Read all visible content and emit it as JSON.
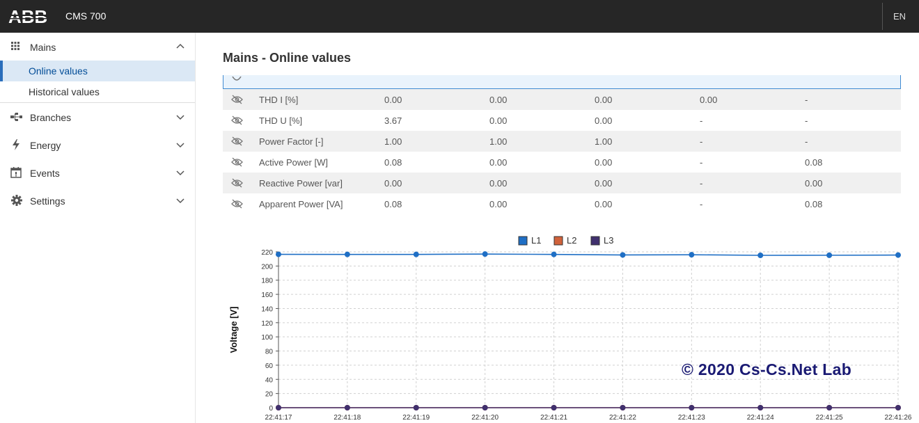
{
  "header": {
    "brand": "ABB",
    "app_title": "CMS 700",
    "language": "EN"
  },
  "sidebar": {
    "groups": [
      {
        "label": "Mains",
        "icon": "grid-icon",
        "expanded": true,
        "items": [
          {
            "label": "Online values",
            "active": true
          },
          {
            "label": "Historical values",
            "active": false
          }
        ]
      },
      {
        "label": "Branches",
        "icon": "branches-icon",
        "expanded": false
      },
      {
        "label": "Energy",
        "icon": "lightning-icon",
        "expanded": false
      },
      {
        "label": "Events",
        "icon": "calendar-icon",
        "expanded": false
      },
      {
        "label": "Settings",
        "icon": "gear-icon",
        "expanded": false
      }
    ]
  },
  "main": {
    "title": "Mains - Online values",
    "table": {
      "rows": [
        {
          "label": "THD I [%]",
          "values": [
            "0.00",
            "0.00",
            "0.00",
            "0.00",
            "-"
          ]
        },
        {
          "label": "THD U [%]",
          "values": [
            "3.67",
            "0.00",
            "0.00",
            "-",
            "-"
          ]
        },
        {
          "label": "Power Factor [-]",
          "values": [
            "1.00",
            "1.00",
            "1.00",
            "-",
            "-"
          ]
        },
        {
          "label": "Active Power [W]",
          "values": [
            "0.08",
            "0.00",
            "0.00",
            "-",
            "0.08"
          ]
        },
        {
          "label": "Reactive Power [var]",
          "values": [
            "0.00",
            "0.00",
            "0.00",
            "-",
            "0.00"
          ]
        },
        {
          "label": "Apparent Power [VA]",
          "values": [
            "0.08",
            "0.00",
            "0.00",
            "-",
            "0.08"
          ]
        }
      ]
    }
  },
  "chart_data": {
    "type": "line",
    "ylabel": "Voltage [V]",
    "xlabel": "",
    "ylim": [
      0,
      220
    ],
    "yticks": [
      0,
      20,
      40,
      60,
      80,
      100,
      120,
      140,
      160,
      180,
      200,
      220
    ],
    "grid": true,
    "legend_position": "top-center",
    "x": [
      "22:41:17",
      "22:41:18",
      "22:41:19",
      "22:41:20",
      "22:41:21",
      "22:41:22",
      "22:41:23",
      "22:41:24",
      "22:41:25",
      "22:41:26"
    ],
    "series": [
      {
        "name": "L1",
        "color": "#1f6fc5",
        "values": [
          216.5,
          216.4,
          216.4,
          216.9,
          216.4,
          215.6,
          215.9,
          215.1,
          215.2,
          215.5
        ]
      },
      {
        "name": "L2",
        "color": "#d0623b",
        "values": [
          0,
          0,
          0,
          0,
          0,
          0,
          0,
          0,
          0,
          0
        ]
      },
      {
        "name": "L3",
        "color": "#40306e",
        "values": [
          0,
          0,
          0,
          0,
          0,
          0,
          0,
          0,
          0,
          0
        ]
      }
    ]
  },
  "watermark": "© 2020 Cs-Cs.Net Lab"
}
